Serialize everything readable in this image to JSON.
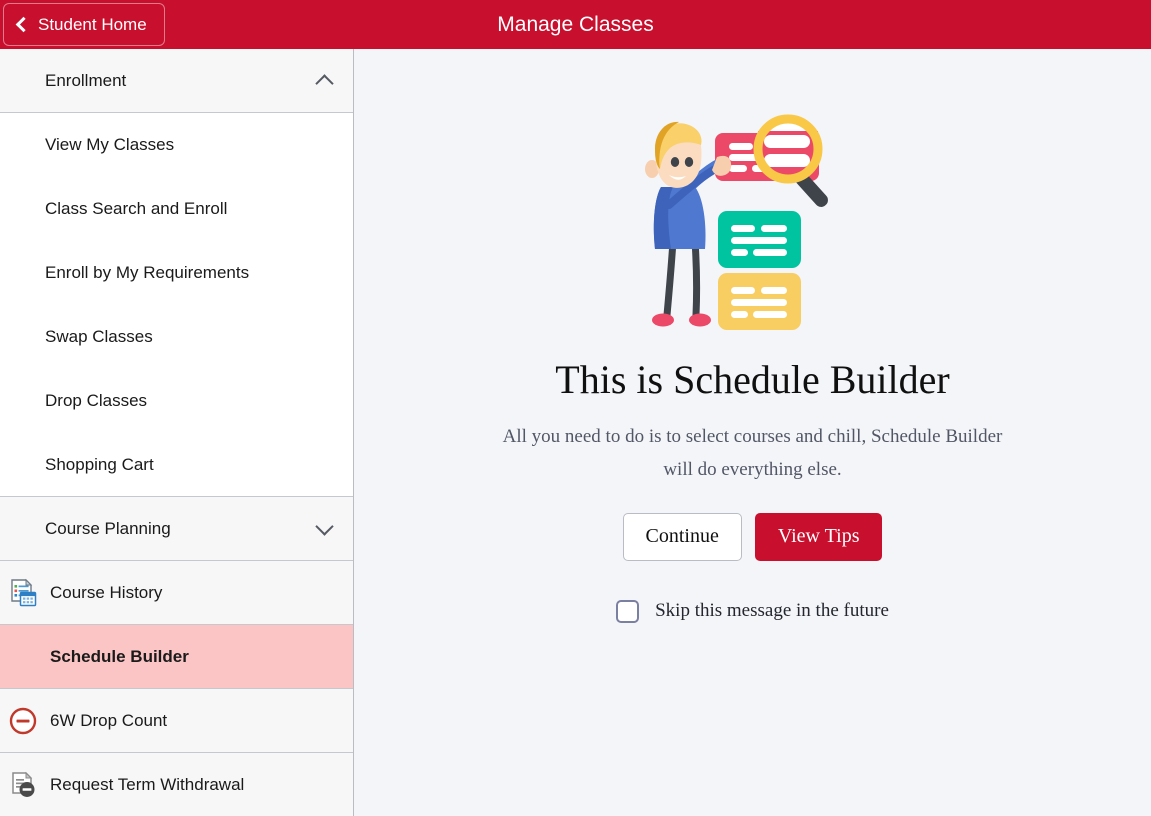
{
  "header": {
    "back_label": "Student Home",
    "back_icon": "chevron-left-icon",
    "title": "Manage Classes",
    "bar_color": "#c8102e"
  },
  "sidebar": {
    "groups": [
      {
        "label": "Enrollment",
        "expanded": true,
        "caret_icon": "chevron-up-icon",
        "items": [
          {
            "label": "View My Classes"
          },
          {
            "label": "Class Search and Enroll"
          },
          {
            "label": "Enroll by My Requirements"
          },
          {
            "label": "Swap Classes"
          },
          {
            "label": "Drop Classes"
          },
          {
            "label": "Shopping Cart"
          }
        ]
      },
      {
        "label": "Course Planning",
        "expanded": false,
        "caret_icon": "chevron-down-icon",
        "items": []
      }
    ],
    "items": [
      {
        "label": "Course History",
        "icon": "course-history-icon",
        "active": false
      },
      {
        "label": "Schedule Builder",
        "icon": "none",
        "active": true
      },
      {
        "label": "6W Drop Count",
        "icon": "minus-circle-icon",
        "active": false
      },
      {
        "label": "Request Term Withdrawal",
        "icon": "document-minus-icon",
        "active": false
      }
    ],
    "active_highlight_color": "#fcc5c5"
  },
  "main": {
    "illustration_name": "schedule-builder-illustration",
    "title": "This is Schedule Builder",
    "subtitle": "All you need to do is to select courses and chill, Schedule Builder will do everything else.",
    "buttons": {
      "continue": "Continue",
      "view_tips": "View Tips"
    },
    "skip_checkbox": {
      "label": "Skip this message in the future",
      "checked": false
    }
  }
}
